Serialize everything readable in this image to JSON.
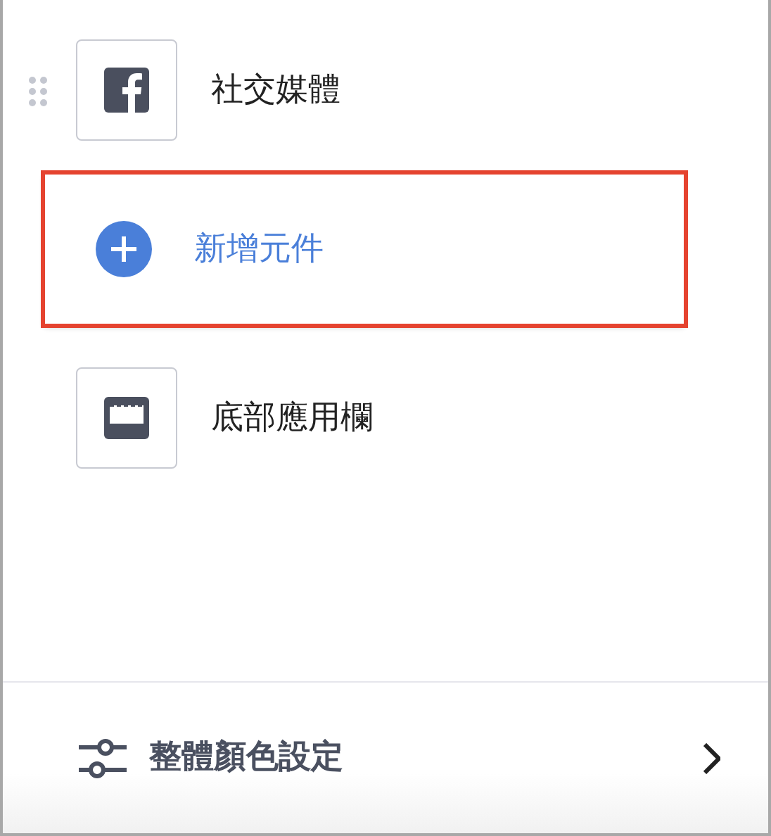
{
  "components": [
    {
      "kind": "widget",
      "label": "社交媒體",
      "drag_handle": true,
      "highlighted": false
    },
    {
      "kind": "add",
      "label": "新增元件",
      "drag_handle": false,
      "highlighted": true
    },
    {
      "kind": "widget",
      "label": "底部應用欄",
      "drag_handle": false,
      "highlighted": false
    }
  ],
  "footer": {
    "label": "整體顏色設定"
  }
}
